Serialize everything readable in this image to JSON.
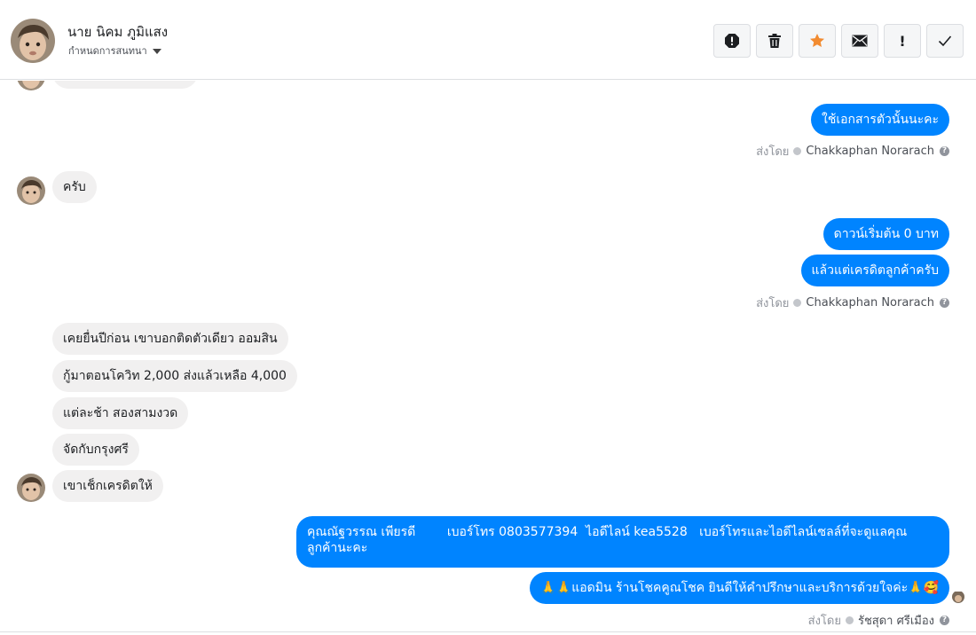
{
  "header": {
    "contact_name": "นาย นิคม ภูมิแสง",
    "subtitle": "กำหนดการสนทนา",
    "actions": [
      {
        "name": "report-icon"
      },
      {
        "name": "trash-icon"
      },
      {
        "name": "star-icon",
        "color": "#f28b30"
      },
      {
        "name": "mail-icon"
      },
      {
        "name": "important-icon",
        "label": "!"
      },
      {
        "name": "check-icon"
      }
    ]
  },
  "messages": {
    "m1": "ใช้เอกสารตัวนั้นนะคะ",
    "m2": "ครับ",
    "m3": "ดาวน์เริ่มต้น 0 บาท",
    "m4": "แล้วแต่เครดิตลูกค้าครับ",
    "m5": "เคยยื่นปีก่อน เขาบอกติดตัวเดียว ออมสิน",
    "m6": "กู้มาตอนโควิท 2,000 ส่งแล้วเหลือ 4,000",
    "m7": "แต่ละช้า สองสามงวด",
    "m8": "จัดกับกรุงศรี",
    "m9": "เขาเช็กเครดิตให้",
    "m10_line1": "คุณณัฐวรรณ เพียรดี        เบอร์โทร 0803577394  ไอดีไลน์ kea5528   เบอร์โทรและไอดีไลน์เซลล์ที่จะดูแลคุณ",
    "m10_line2": "ลูกค้านะคะ",
    "m11": "🙏🙏แอดมิน ร้านโชคคูณโชค ยินดีให้คำปรึกษาและบริการด้วยใจค่ะ🙏🥰"
  },
  "senders": {
    "prefix": "ส่งโดย",
    "s1": "Chakkaphan Norarach",
    "s2": "Chakkaphan Norarach",
    "s3": "รัชสุดา ศรีเมือง"
  },
  "colors": {
    "accent": "#0084ff",
    "incoming": "#f1f0f0"
  }
}
